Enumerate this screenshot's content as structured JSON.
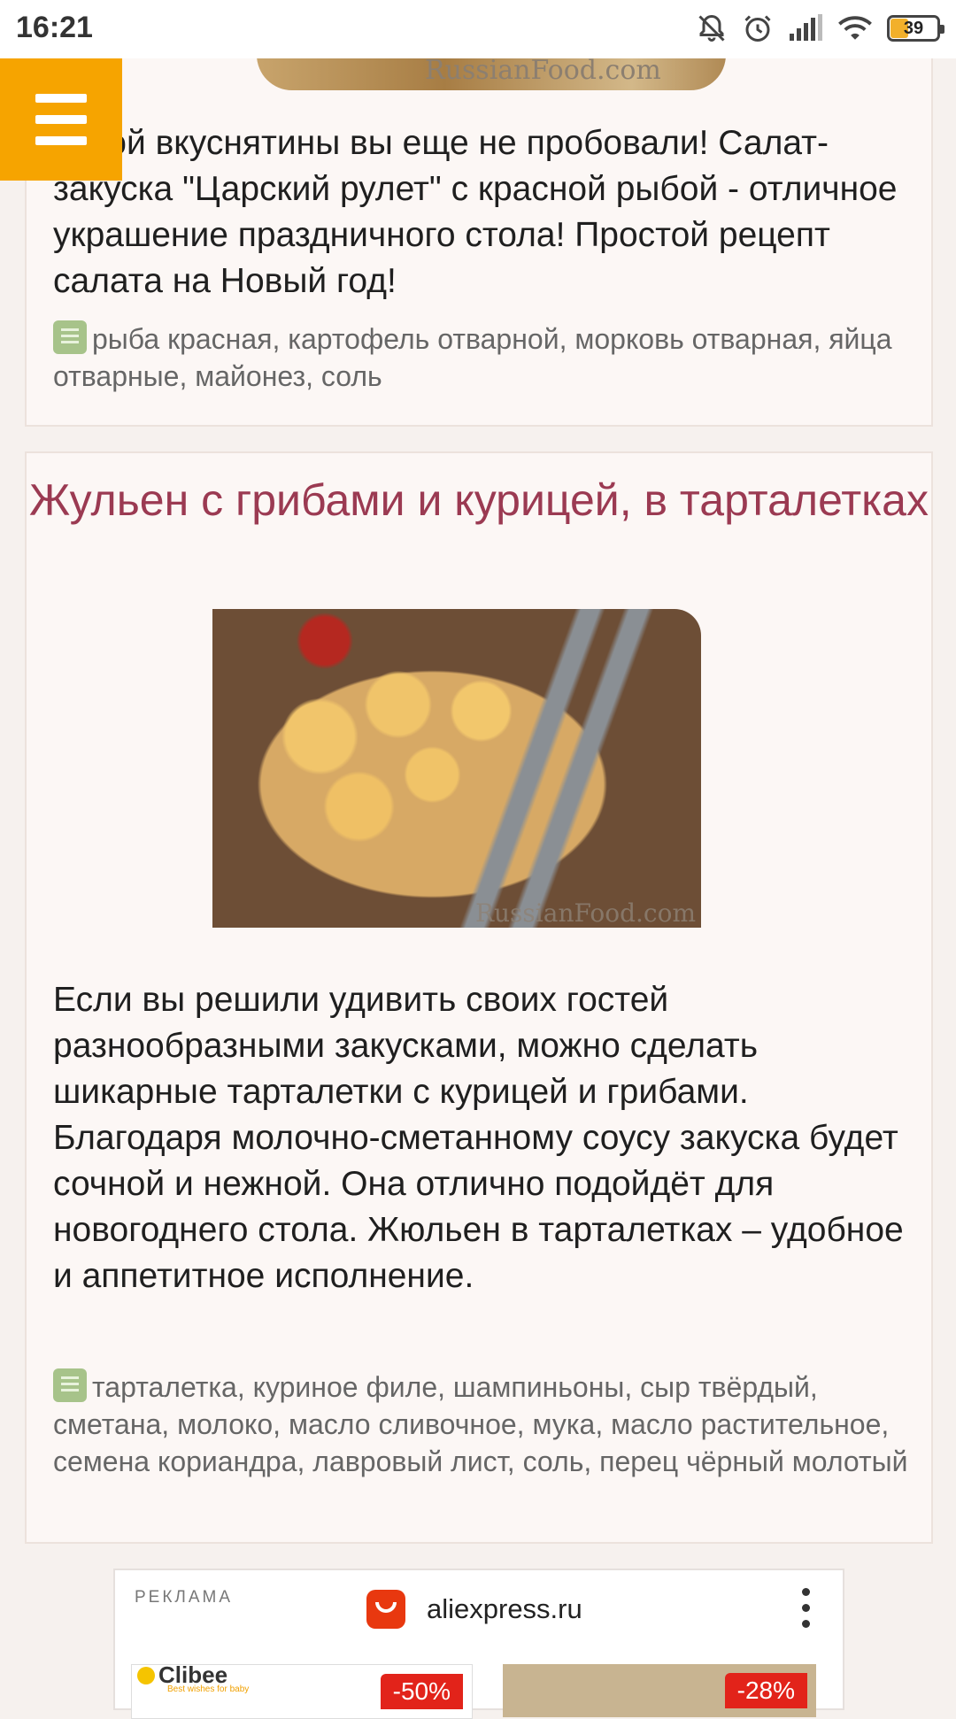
{
  "status_bar": {
    "time": "16:21",
    "icons": [
      "bell-off-icon",
      "alarm-icon",
      "signal-icon",
      "wifi-icon",
      "battery-icon"
    ],
    "battery_level": "39"
  },
  "menu": {
    "icon": "hamburger-menu-icon",
    "accent_color": "#f6a400"
  },
  "card1": {
    "image_watermark": "RussianFood.com",
    "description": "Такой вкуснятины вы еще не пробовали! Салат-закуска \"Царский рулет\" с красной рыбой - отличное украшение праздничного стола! Простой рецепт салата на Новый год!",
    "ingredients": "рыба красная, картофель отварной, морковь отварная, яйца отварные, майонез, соль"
  },
  "card2": {
    "title": "Жульен с грибами и курицей, в тарталетках",
    "title_color": "#9b3a52",
    "image_watermark": "RussianFood.com",
    "description": "Если вы решили удивить своих гостей разнообразными закусками, можно сделать шикарные тарталетки с курицей и грибами. Благодаря молочно-сметанному соусу закуска будет сочной и нежной. Она отлично подойдёт для новогоднего стола. Жюльен в тарталетках – удобное и аппетитное исполнение.",
    "ingredients": "тарталетка, куриное филе, шампиньоны, сыр твёрдый, сметана, молоко, масло сливочное, мука, масло растительное, семена кориандра, лавровый лист, соль, перец чёрный молотый"
  },
  "ad": {
    "label": "РЕКЛАМА",
    "domain": "aliexpress.ru",
    "brand": "Clibee",
    "brand_tagline": "Best wishes for baby",
    "discounts": [
      "-50%",
      "-28%"
    ]
  }
}
